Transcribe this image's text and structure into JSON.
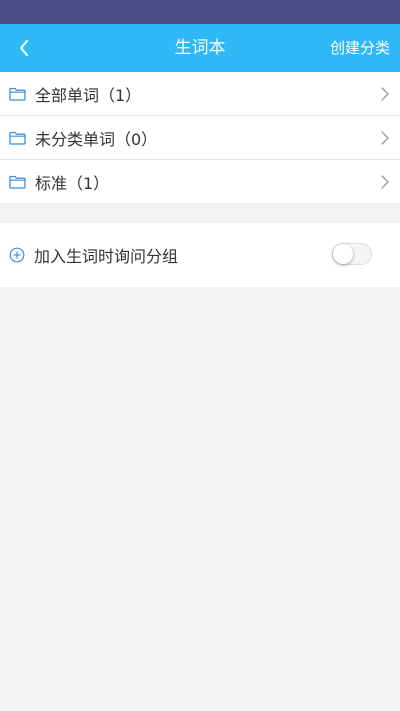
{
  "header": {
    "title": "生词本",
    "back_icon": "chevron-left-icon",
    "action_label": "创建分类"
  },
  "folders": [
    {
      "label": "全部单词（1）",
      "icon": "folder-icon"
    },
    {
      "label": "未分类单词（0）",
      "icon": "folder-icon"
    },
    {
      "label": "标准（1）",
      "icon": "folder-icon"
    }
  ],
  "options": {
    "ask_group_label": "加入生词时询问分组",
    "ask_group_enabled": false
  },
  "colors": {
    "status_bar": "#4c4b84",
    "header_bg": "#2fb8f6",
    "icon_accent": "#3a8ee6",
    "page_bg": "#f3f3f3"
  }
}
